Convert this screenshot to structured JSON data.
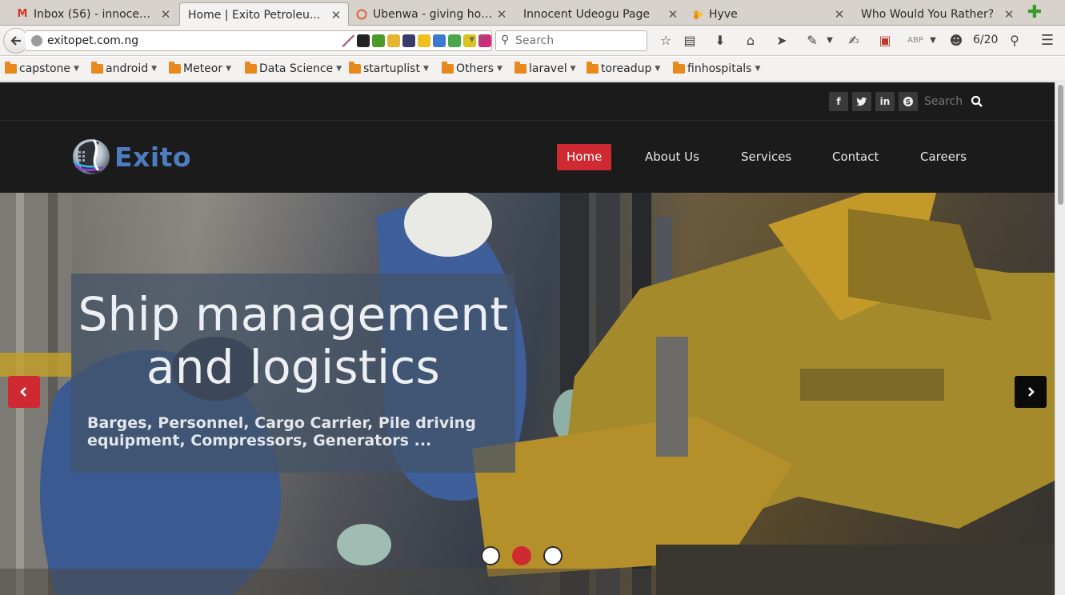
{
  "browser": {
    "tabs": [
      {
        "title": "Inbox (56) - innocent...",
        "favicon": "gmail-icon",
        "active": false
      },
      {
        "title": "Home | Exito Petroleu...",
        "favicon": "none",
        "active": true
      },
      {
        "title": "Ubenwa - giving hop...",
        "favicon": "ubenwa-icon",
        "active": false
      },
      {
        "title": "Innocent Udeogu Page",
        "favicon": "none",
        "active": false
      },
      {
        "title": "Hyve",
        "favicon": "hyve-icon",
        "active": false
      },
      {
        "title": "Who Would You Rather?",
        "favicon": "none",
        "active": false
      }
    ],
    "url": "exitopet.com.ng",
    "search_placeholder": "Search",
    "tab_counter": "6/20",
    "bookmarks": [
      "capstone",
      "android",
      "Meteor",
      "Data Science",
      "startuplist",
      "Others",
      "laravel",
      "toreadup",
      "finhospitals"
    ],
    "accent_color": "#e8891e"
  },
  "site": {
    "top_search_placeholder": "Search",
    "social": [
      "facebook-icon",
      "twitter-icon",
      "linkedin-icon",
      "skype-icon"
    ],
    "logo_text": "Exito",
    "nav": [
      "Home",
      "About Us",
      "Services",
      "Contact",
      "Careers"
    ],
    "active_nav": "Home",
    "brand_color": "#cf2a32",
    "logo_color": "#4e7cc0"
  },
  "hero": {
    "title_line1": "Ship management",
    "title_line2": "and logistics",
    "subtitle": "Barges, Personnel, Cargo Carrier, Pile driving equipment, Compressors, Generators ...",
    "slides_total": 3,
    "active_slide": 2
  }
}
